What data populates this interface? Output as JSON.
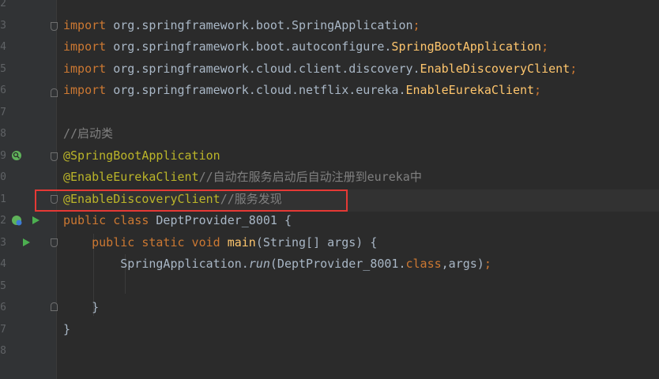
{
  "editor": {
    "line_numbers": [
      "2",
      "3",
      "4",
      "5",
      "6",
      "7",
      "8",
      "9",
      "0",
      "1",
      "2",
      "3",
      "4",
      "5",
      "6",
      "7",
      "8"
    ],
    "lines": [
      {
        "parts": [
          {
            "t": "import ",
            "c": "kw"
          },
          {
            "t": "org.springframework.boot.",
            "c": ""
          },
          {
            "t": "SpringApplication",
            "c": ""
          },
          {
            "t": ";",
            "c": "kw"
          }
        ]
      },
      {
        "parts": [
          {
            "t": "import ",
            "c": "kw"
          },
          {
            "t": "org.springframework.boot.autoconfigure.",
            "c": ""
          },
          {
            "t": "SpringBootApplication",
            "c": "cls"
          },
          {
            "t": ";",
            "c": "kw"
          }
        ]
      },
      {
        "parts": [
          {
            "t": "import ",
            "c": "kw"
          },
          {
            "t": "org.springframework.cloud.client.discovery.",
            "c": ""
          },
          {
            "t": "EnableDiscoveryClient",
            "c": "cls"
          },
          {
            "t": ";",
            "c": "kw"
          }
        ]
      },
      {
        "parts": [
          {
            "t": "import ",
            "c": "kw"
          },
          {
            "t": "org.springframework.cloud.netflix.eureka.",
            "c": ""
          },
          {
            "t": "EnableEurekaClient",
            "c": "cls"
          },
          {
            "t": ";",
            "c": "kw"
          }
        ]
      },
      {
        "parts": [
          {
            "t": "//启动类",
            "c": "cmt"
          }
        ]
      },
      {
        "parts": [
          {
            "t": "@SpringBootApplication",
            "c": "ann"
          }
        ]
      },
      {
        "parts": [
          {
            "t": "@EnableEurekaClient",
            "c": "ann"
          },
          {
            "t": "//自动在服务启动后自动注册到eureka中",
            "c": "cmt"
          }
        ]
      },
      {
        "parts": [
          {
            "t": "@EnableDiscoveryClient",
            "c": "ann"
          },
          {
            "t": "//服务发现",
            "c": "cmt"
          }
        ]
      },
      {
        "parts": [
          {
            "t": "public class ",
            "c": "kw"
          },
          {
            "t": "DeptProvider_8001 {",
            "c": ""
          }
        ]
      },
      {
        "parts": [
          {
            "t": "    public static void ",
            "c": "kw"
          },
          {
            "t": "main",
            "c": "fn"
          },
          {
            "t": "(String[] args) {",
            "c": ""
          }
        ]
      },
      {
        "parts": [
          {
            "t": "        SpringApplication.",
            "c": ""
          },
          {
            "t": "run",
            "c": "it"
          },
          {
            "t": "(DeptProvider_8001.",
            "c": ""
          },
          {
            "t": "class",
            "c": "kw"
          },
          {
            "t": ",args)",
            "c": ""
          },
          {
            "t": ";",
            "c": "kw"
          }
        ]
      },
      {
        "parts": [
          {
            "t": "    }",
            "c": ""
          }
        ]
      },
      {
        "parts": [
          {
            "t": "}",
            "c": ""
          }
        ]
      }
    ]
  },
  "gutter_icons": {
    "spring_bean": "spring-bean-icon",
    "run": "run-icon"
  },
  "colors": {
    "background": "#2b2b2b",
    "keyword": "#cc7832",
    "annotation": "#bbb529",
    "class_name": "#ffc66d",
    "comment": "#808080",
    "highlight_box": "#e53935"
  }
}
